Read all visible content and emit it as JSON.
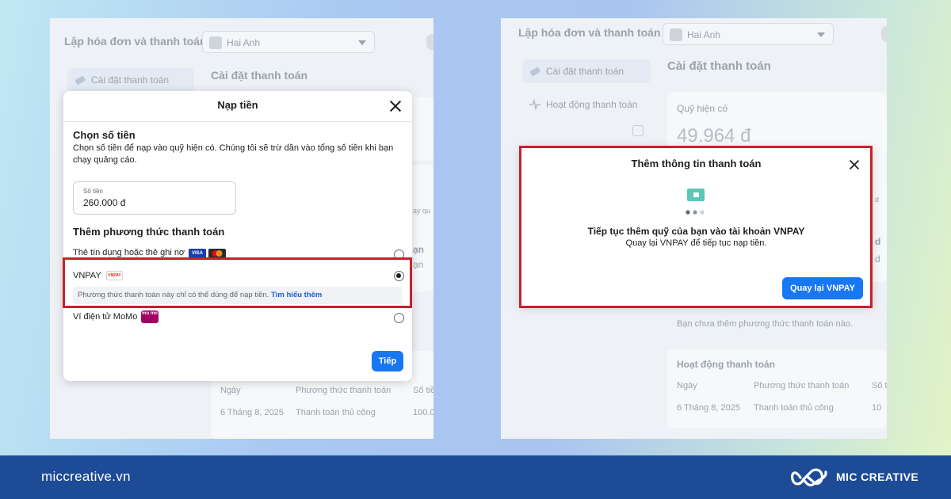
{
  "left": {
    "header_title": "Lập hóa đơn và thanh toán",
    "account_name": "Hai Anh",
    "nav_active": "Cài đặt thanh toán",
    "page_title": "Cài đặt thanh toán",
    "peek": [
      "Ngày",
      "Phương thức thanh toán",
      "Số tiề",
      "6 Tháng 8, 2025",
      "Thanh toán thủ công",
      "100.0",
      "ạy qu",
      "ạn",
      "ạn"
    ],
    "modal": {
      "title": "Nạp tiền",
      "section1_heading": "Chọn số tiền",
      "section1_desc": "Chọn số tiền để nạp vào quỹ hiện có. Chúng tôi sẽ trừ dần vào tổng số tiền khi bạn chạy quảng cáo.",
      "amount_label": "Số tiền",
      "amount_value": "260.000 đ",
      "section2_heading": "Thêm phương thức thanh toán",
      "option_card": "Thẻ tín dụng hoặc thẻ ghi nợ",
      "option_vnpay": "VNPAY",
      "vnpay_note": "Phương thức thanh toán này chỉ có thể dùng để nạp tiền.",
      "vnpay_note_link": "Tìm hiểu thêm",
      "option_momo": "Ví điện tử MoMo",
      "next_button": "Tiếp",
      "selected_option": "VNPAY"
    }
  },
  "right": {
    "header_title": "Lập hóa đơn và thanh toán",
    "account_name": "Hai Anh",
    "nav_active": "Cài đặt thanh toán",
    "nav_activity": "Hoạt động thanh toán",
    "page_title": "Cài đặt thanh toán",
    "funds_label": "Quỹ hiện có",
    "funds_value": "49.964 đ",
    "no_methods": "Bạn chưa thêm phương thức thanh toán nào.",
    "activity_title": "Hoạt động thanh toán",
    "table_headers": [
      "Ngày",
      "Phương thức thanh toán",
      "Số t"
    ],
    "table_row": [
      "6 Tháng 8, 2025",
      "Thanh toán thủ công",
      "10"
    ],
    "peek": [
      "d",
      "d",
      "d",
      "d"
    ],
    "modal": {
      "title": "Thêm thông tin thanh toán",
      "heading": "Tiếp tục thêm quỹ của bạn vào tài khoản VNPAY",
      "subtext": "Quay lại VNPAY để tiếp tục nạp tiền.",
      "button": "Quay lại VNPAY"
    }
  },
  "footer": {
    "site": "miccreative.vn",
    "brand": "MIC CREATIVE"
  },
  "colors": {
    "highlight": "#c8202b",
    "primary": "#1877f2",
    "footer": "#1e4b96"
  },
  "icons": {
    "visa": "VISA",
    "vnpay": "VNPAY",
    "momo": "mo mo"
  }
}
